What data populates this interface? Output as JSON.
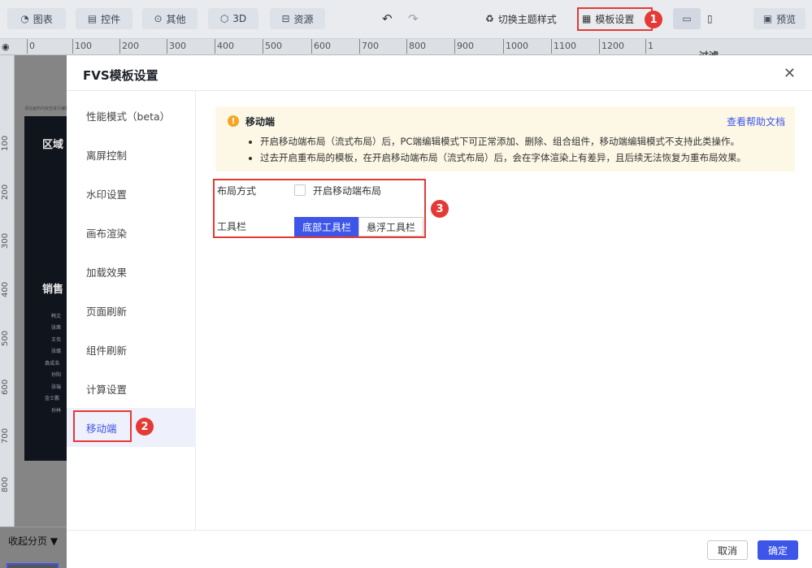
{
  "toolbar": {
    "chart_label": "图表",
    "widget_label": "控件",
    "other_label": "其他",
    "three_d_label": "3D",
    "resource_label": "资源",
    "theme_label": "切换主题样式",
    "template_settings_label": "模板设置",
    "preview_label": "预览"
  },
  "annotations": {
    "badge1": "1",
    "badge2": "2",
    "badge3": "3"
  },
  "ruler": {
    "top_ticks": [
      "0",
      "100",
      "200",
      "300",
      "400",
      "500",
      "600",
      "700",
      "800",
      "900",
      "1000",
      "1100",
      "1200",
      "1"
    ],
    "left_ticks": [
      "100",
      "200",
      "300",
      "400",
      "500",
      "600",
      "700",
      "800"
    ]
  },
  "canvas": {
    "hint": "请在画布内双击进行编辑",
    "panel_title_1": "区域",
    "panel_title_2": "销售",
    "names": [
      "韩文",
      "张茜",
      "王伟",
      "张璐",
      "袁成浩",
      "孙阳",
      "张瑞",
      "金士鹏",
      "孙林"
    ],
    "right_title": "过滤"
  },
  "bottom": {
    "collapse_label": "收起分页 ▼"
  },
  "dialog": {
    "title": "FVS模板设置",
    "sidebar": [
      "性能模式（beta）",
      "离屏控制",
      "水印设置",
      "画布渲染",
      "加载效果",
      "页面刷新",
      "组件刷新",
      "计算设置",
      "移动端"
    ],
    "notice": {
      "title": "移动端",
      "help_link": "查看帮助文档",
      "lines": [
        "开启移动端布局（流式布局）后，PC端编辑模式下可正常添加、删除、组合组件，移动端编辑模式不支持此类操作。",
        "过去开启重布局的模板，在开启移动端布局（流式布局）后，会在字体渲染上有差异，且后续无法恢复为重布局效果。"
      ]
    },
    "form": {
      "layout_label": "布局方式",
      "mobile_layout_checkbox": "开启移动端布局",
      "toolbar_label": "工具栏",
      "toolbar_options": [
        "底部工具栏",
        "悬浮工具栏"
      ],
      "toolbar_selected": "底部工具栏"
    },
    "footer": {
      "cancel": "取消",
      "ok": "确定"
    }
  },
  "colors": {
    "accent": "#3d55e8",
    "annotation": "#e53935",
    "warning": "#f5a623"
  }
}
